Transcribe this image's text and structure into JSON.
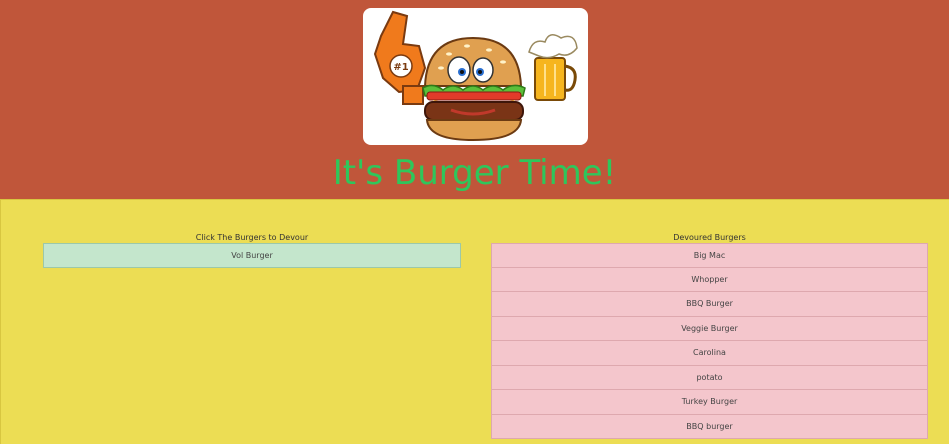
{
  "header": {
    "logo_name": "burger-mascot-logo",
    "title": "It's Burger Time!",
    "logo_badge": "#1"
  },
  "uneaten": {
    "heading": "Click The Burgers to Devour",
    "items": [
      "Vol Burger"
    ]
  },
  "devoured": {
    "heading": "Devoured Burgers",
    "items": [
      "Big Mac",
      "Whopper",
      "BBQ Burger",
      "Veggie Burger",
      "Carolina",
      "potato",
      "Turkey Burger",
      "BBQ burger"
    ]
  },
  "colors": {
    "header_bg": "#c0563a",
    "body_bg": "#ecdd54",
    "title_green": "#2fc65b",
    "uneaten_bg": "#c4e6cc",
    "devoured_bg": "#f4c6cc"
  }
}
